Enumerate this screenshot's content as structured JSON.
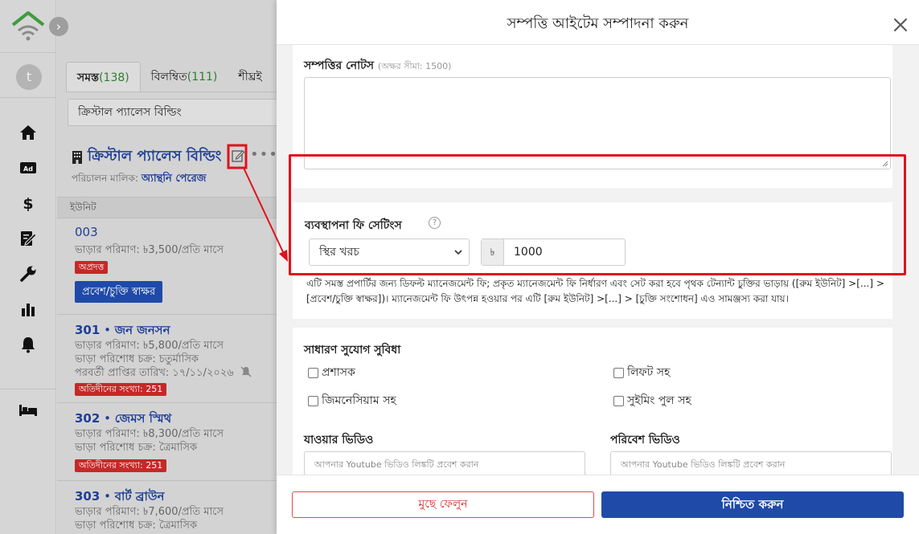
{
  "colors": {
    "primary": "#1f4aa8",
    "danger": "#d32f2f",
    "annotation": "#e0111c",
    "count_green": "#2e7d32"
  },
  "rail": {
    "avatar_letter": "t",
    "icons": [
      "house-logo-icon",
      "home-icon",
      "ad-icon",
      "dollar-icon",
      "document-edit-icon",
      "wrench-icon",
      "bar-chart-icon",
      "bell-icon",
      "bed-icon"
    ]
  },
  "list": {
    "tabs": [
      {
        "label": "সমস্ত",
        "count": "(138)"
      },
      {
        "label": "বিলম্বিত",
        "count": "(111)"
      },
      {
        "label": "শীঘ্রই",
        "count": ""
      }
    ],
    "search_value": "ক্রিস্টাল প্যালেস বিল্ডিং",
    "property": {
      "title": "ক্রিস্টাল প্যালেস বিল্ডিং",
      "owner_label": "পরিচালন মালিক:",
      "owner_name": "অ্যান্থনি পেরেজ"
    },
    "units_header": "ইউনিট",
    "units": [
      {
        "number": "003",
        "tenant": "",
        "rent": "ভাড়ার পরিমাণ: ৳3,500/প্রতি মাসে",
        "status_badge": "অপ্রদত্ত",
        "action_label": "প্রবেশ/চুক্তি স্বাক্ষর"
      },
      {
        "number": "301",
        "tenant": "জন জনসন",
        "rent": "ভাড়ার পরিমাণ: ৳5,800/প্রতি মাসে",
        "cycle": "ভাড়া পরিশোধ চক্র: চতুর্মাসিক",
        "next_date": "পরবর্তী প্রাপ্তির তারিখ: ১৭/১১/২০২৬",
        "overdue_badge": "অতিদীনের সংখ্যা: 251"
      },
      {
        "number": "302",
        "tenant": "জেমস স্মিথ",
        "rent": "ভাড়ার পরিমাণ: ৳8,300/প্রতি মাসে",
        "cycle": "ভাড়া পরিশোধ চক্র: ত্রৈমাসিক",
        "overdue_badge": "অতিদীনের সংখ্যা: 251"
      },
      {
        "number": "303",
        "tenant": "বার্ট ব্রাউন",
        "rent": "ভাড়ার পরিমাণ: ৳7,600/প্রতি মাসে",
        "cycle": "ভাড়া পরিশোধ চক্র: ত্রৈমাসিক"
      }
    ]
  },
  "modal": {
    "title": "সম্পত্তি আইটেম সম্পাদনা করুন",
    "notes": {
      "label": "সম্পত্তির নোটস",
      "hint": "(অক্ষর সীমা: 1500)",
      "value": ""
    },
    "fee": {
      "label": "ব্যবস্থাপনা ফি সেটিংস",
      "help_symbol": "?",
      "type_selected": "স্থির খরচ",
      "currency_symbol": "৳",
      "amount": "1000",
      "description": "এটি সমস্ত প্রপার্টির জন্য ডিফল্ট ম্যানেজমেন্ট ফি; প্রকৃত ম্যানেজমেন্ট ফি নির্ধারণ এবং সেট করা হবে পৃথক টেন্যান্ট চুক্তির ভাড়ায় ([রুম ইউনিট] >[...] > [প্রবেশ/চুক্তি স্বাক্ষর])। ম্যানেজমেন্ট ফি উৎপন্ন হওয়ার পর এটি [রুম ইউনিট] >[...] > [চুক্তি সংশোধন] এও সামঞ্জস্য করা যায়।"
    },
    "amenities": {
      "label": "সাধারণ সুযোগ সুবিধা",
      "items": [
        "প্রশাসক",
        "লিফট সহ",
        "জিমনেসিয়াম সহ",
        "সুইমিং পুল সহ"
      ]
    },
    "videos": {
      "walk_label": "যাওয়ার ভিডিও",
      "env_label": "পরিবেশ ভিডিও",
      "placeholder": "আপনার Youtube ভিডিও লিঙ্কটি প্রবেশ করান"
    },
    "footer": {
      "delete_label": "মুছে ফেলুন",
      "confirm_label": "নিশ্চিত করুন"
    }
  }
}
